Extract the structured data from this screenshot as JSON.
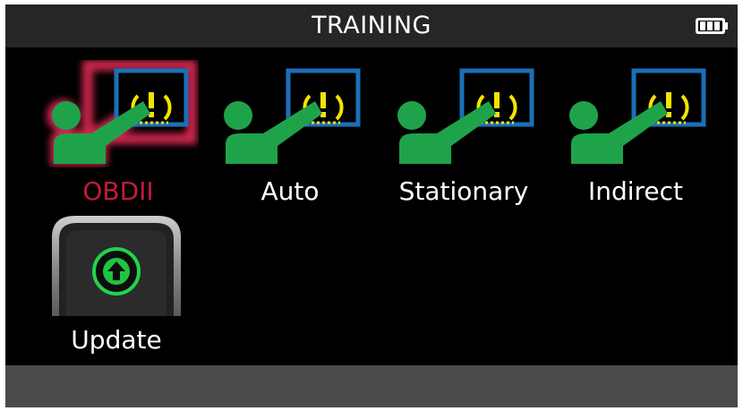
{
  "header": {
    "title": "TRAINING",
    "battery_icon": "battery-full-icon"
  },
  "menu": {
    "items": [
      {
        "label": "OBDII",
        "icon": "tpms-training-icon",
        "selected": true
      },
      {
        "label": "Auto",
        "icon": "tpms-training-icon",
        "selected": false
      },
      {
        "label": "Stationary",
        "icon": "tpms-training-icon",
        "selected": false
      },
      {
        "label": "Indirect",
        "icon": "tpms-training-icon",
        "selected": false
      }
    ],
    "update": {
      "label": "Update",
      "icon": "update-arrow-icon"
    }
  },
  "colors": {
    "selected_text": "#c31b3a",
    "selected_glow": "#e02a55",
    "person": "#1fa34a",
    "screen_frame": "#1b6fb8",
    "warning": "#f4e400"
  }
}
